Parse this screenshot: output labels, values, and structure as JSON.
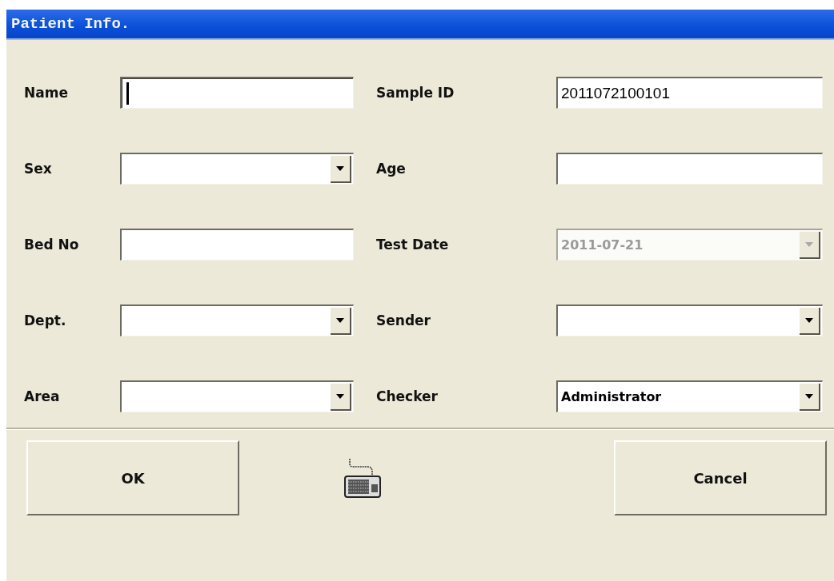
{
  "window": {
    "title": "Patient Info."
  },
  "fields": [
    {
      "label": "Name",
      "kind": "text",
      "focused": true,
      "disabled": false
    },
    {
      "label": "Sample ID",
      "kind": "text",
      "value": "2011072100101",
      "focused": false,
      "disabled": false
    },
    {
      "label": "Sex",
      "kind": "combo",
      "focused": false,
      "disabled": false
    },
    {
      "label": "Age",
      "kind": "text",
      "focused": false,
      "disabled": false
    },
    {
      "label": "Bed No",
      "kind": "text",
      "focused": false,
      "disabled": false
    },
    {
      "label": "Test Date",
      "kind": "combo",
      "value": "2011-07-21",
      "focused": false,
      "disabled": true
    },
    {
      "label": "Dept.",
      "kind": "combo",
      "focused": false,
      "disabled": false
    },
    {
      "label": "Sender",
      "kind": "combo",
      "focused": false,
      "disabled": false
    },
    {
      "label": "Area",
      "kind": "combo",
      "focused": false,
      "disabled": false
    },
    {
      "label": "Checker",
      "kind": "combo",
      "value": "Administrator",
      "focused": false,
      "disabled": false
    }
  ],
  "buttons": [
    {
      "label": "OK"
    },
    {
      "label": "Cancel"
    }
  ]
}
